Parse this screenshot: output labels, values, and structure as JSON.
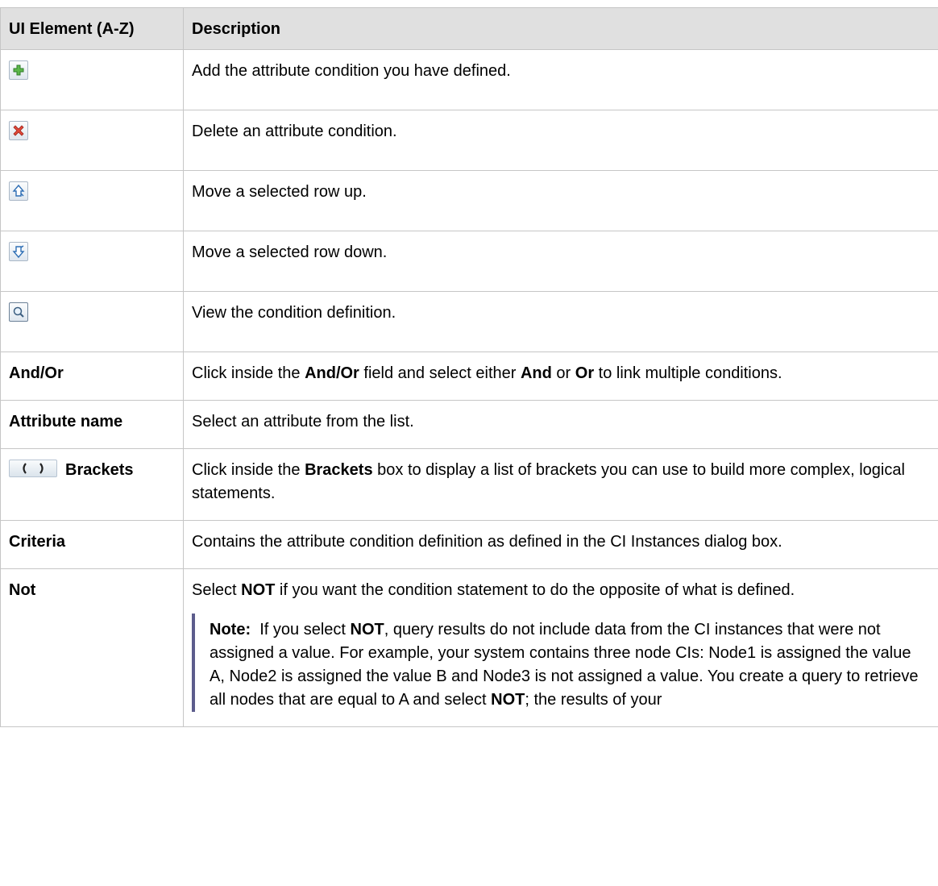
{
  "table": {
    "headers": {
      "element": "UI Element (A-Z)",
      "description": "Description"
    },
    "icon_rows": [
      {
        "icon": "add-icon",
        "description": "Add the attribute condition you have defined."
      },
      {
        "icon": "delete-icon",
        "description": "Delete an attribute condition."
      },
      {
        "icon": "move-up-icon",
        "description": "Move a selected row up."
      },
      {
        "icon": "move-down-icon",
        "description": "Move a selected row down."
      },
      {
        "icon": "view-icon",
        "description": "View the condition definition."
      }
    ],
    "andor": {
      "element": "And/Or",
      "d1": "Click inside the ",
      "b1": "And/Or",
      "d2": " field and select either ",
      "b2": "And",
      "d3": " or ",
      "b3": "Or",
      "d4": " to link multiple conditions."
    },
    "attribute_name": {
      "element": "Attribute name",
      "description": "Select an attribute from the list."
    },
    "brackets": {
      "element": "Brackets",
      "icon": "brackets-icon",
      "d1": "Click inside the ",
      "b1": "Brackets",
      "d2": " box to display a list of brackets you can use to build more complex, logical statements."
    },
    "criteria": {
      "element": "Criteria",
      "description": "Contains the attribute condition definition as defined in the CI Instances dialog box."
    },
    "not": {
      "element": "Not",
      "d1": "Select ",
      "b1": "NOT",
      "d2": " if you want the condition statement to do the opposite of what is defined.",
      "note": {
        "label": "Note:",
        "t1": "  If you select ",
        "b1": "NOT",
        "t2": ", query results do not include data from the CI instances that were not assigned a value. For example, your system contains three node CIs: Node1 is assigned the value A, Node2 is assigned the value B and Node3 is not assigned a value. You create a query to retrieve all nodes that are equal to A and select ",
        "b2": "NOT",
        "t3": "; the results of your"
      }
    }
  }
}
